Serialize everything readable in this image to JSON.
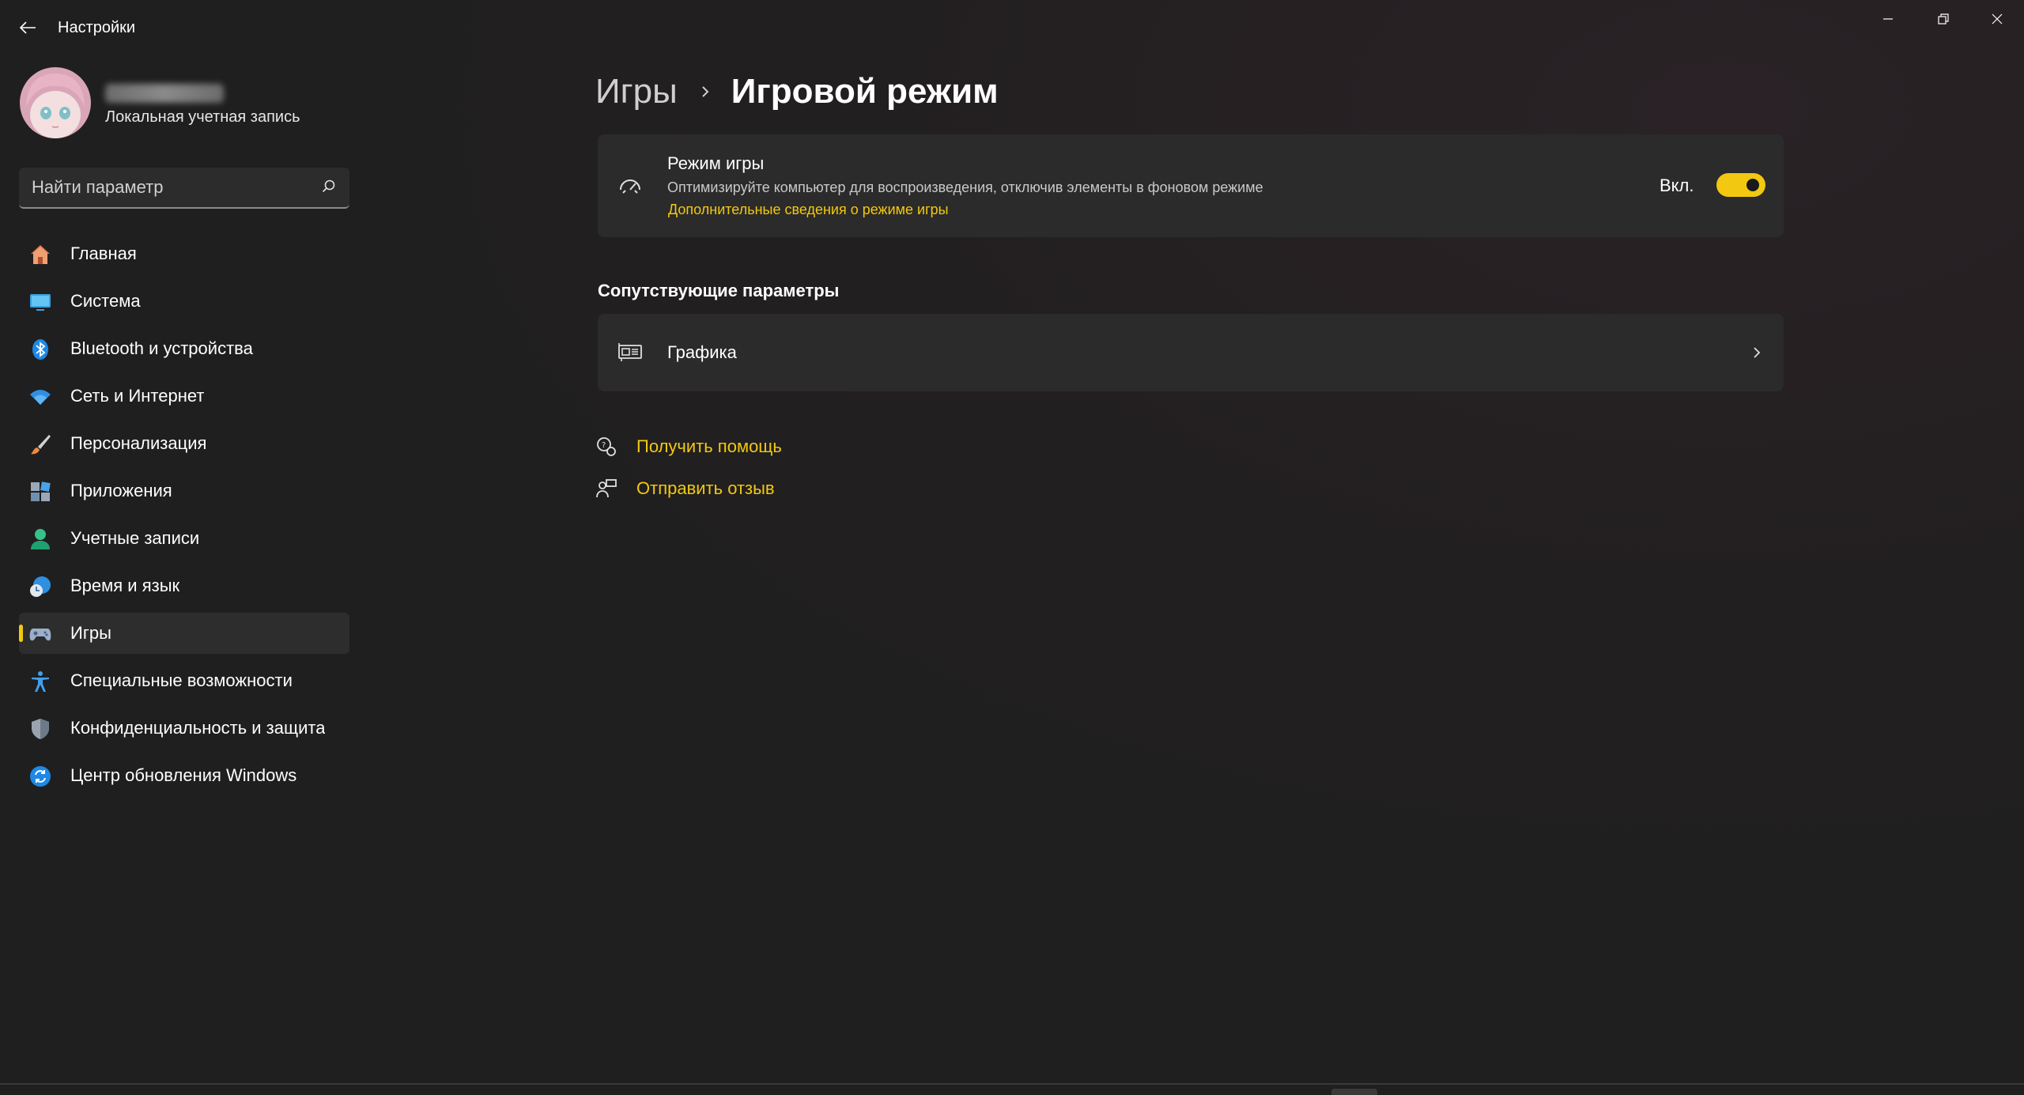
{
  "window": {
    "title": "Настройки"
  },
  "profile": {
    "account_type": "Локальная учетная запись"
  },
  "search": {
    "placeholder": "Найти параметр"
  },
  "sidebar": {
    "items": [
      {
        "label": "Главная",
        "icon": "home-icon"
      },
      {
        "label": "Система",
        "icon": "system-icon"
      },
      {
        "label": "Bluetooth и устройства",
        "icon": "bluetooth-icon"
      },
      {
        "label": "Сеть и Интернет",
        "icon": "wifi-icon"
      },
      {
        "label": "Персонализация",
        "icon": "brush-icon"
      },
      {
        "label": "Приложения",
        "icon": "apps-icon"
      },
      {
        "label": "Учетные записи",
        "icon": "account-icon"
      },
      {
        "label": "Время и язык",
        "icon": "clock-globe-icon"
      },
      {
        "label": "Игры",
        "icon": "gamepad-icon",
        "active": true
      },
      {
        "label": "Специальные возможности",
        "icon": "accessibility-icon"
      },
      {
        "label": "Конфиденциальность и защита",
        "icon": "shield-icon"
      },
      {
        "label": "Центр обновления Windows",
        "icon": "update-icon"
      }
    ]
  },
  "breadcrumb": {
    "parent": "Игры",
    "current": "Игровой режим"
  },
  "game_mode": {
    "title": "Режим игры",
    "description": "Оптимизируйте компьютер для воспроизведения, отключив элементы в фоновом режиме",
    "link": "Дополнительные сведения о режиме игры",
    "toggle_label": "Вкл.",
    "enabled": true
  },
  "related": {
    "section_title": "Сопутствующие параметры",
    "graphics_label": "Графика"
  },
  "help_links": {
    "get_help": "Получить помощь",
    "feedback": "Отправить отзыв"
  },
  "colors": {
    "accent": "#f2c811",
    "background": "#1f1f1f",
    "card": "#2b2b2b"
  }
}
